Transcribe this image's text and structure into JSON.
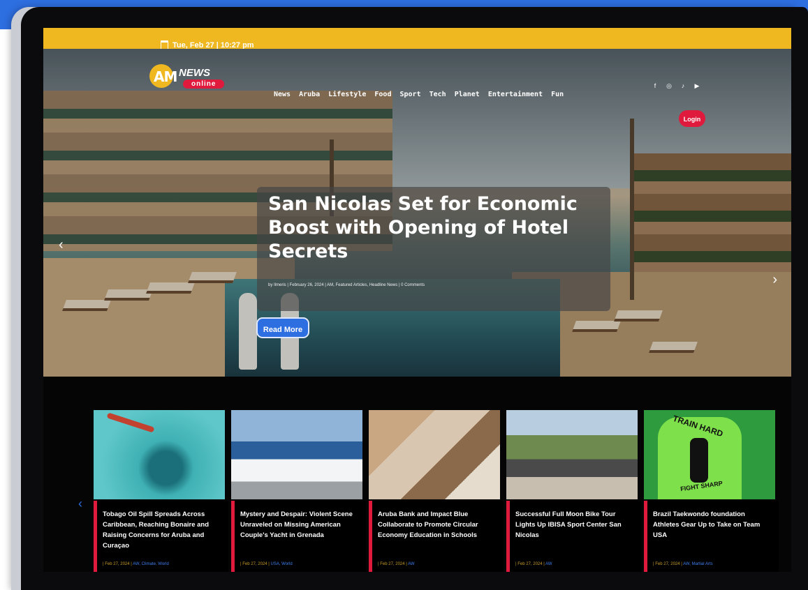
{
  "topbar": {
    "date_time": "Tue, Feb 27 | 10:27 pm"
  },
  "logo": {
    "am": "AM",
    "news": "NEWS",
    "online": "online"
  },
  "nav": {
    "items": [
      "News",
      "Aruba",
      "Lifestyle",
      "Food",
      "Sport",
      "Tech",
      "Planet",
      "Entertainment",
      "Fun"
    ]
  },
  "login": {
    "label": "Login"
  },
  "social_icons": [
    "facebook-icon",
    "instagram-icon",
    "tiktok-icon",
    "youtube-icon"
  ],
  "hero": {
    "headline": "San Nicolas Set for Economic Boost with Opening of Hotel Secrets",
    "meta": "by Ilmeris | February 26, 2024 | AM, Featured Articles, Headline News | 0 Comments",
    "read_more": "Read More",
    "prev_arrow": "‹",
    "next_arrow": "›"
  },
  "cards": [
    {
      "title": "Tobago Oil Spill Spreads Across Caribbean, Reaching Bonaire and Raising Concerns for Aruba and Curaçao",
      "date": "| Feb 27, 2024 |",
      "tags": "AW, Climate, World"
    },
    {
      "title": "Mystery and Despair: Violent Scene Unraveled on Missing American Couple's Yacht in Grenada",
      "date": "| Feb 27, 2024 |",
      "tags": "USA, World"
    },
    {
      "title": "Aruba Bank and Impact Blue Collaborate to Promote Circular Economy Education in Schools",
      "date": "| Feb 27, 2024 |",
      "tags": "AW"
    },
    {
      "title": "Successful Full Moon Bike Tour Lights Up IBISA Sport Center San Nicolas",
      "date": "| Feb 27, 2024 |",
      "tags": "AW"
    },
    {
      "title": "Brazil Taekwondo foundation Athletes Gear Up to Take on Team USA",
      "date": "| Feb 27, 2024 |",
      "tags": "AW, Martial Arts"
    }
  ],
  "card_image_text": {
    "train_hard": "TRAIN HARD",
    "fight_sharp": "FIGHT SHARP"
  },
  "carousel": {
    "prev": "‹",
    "next": "›"
  }
}
